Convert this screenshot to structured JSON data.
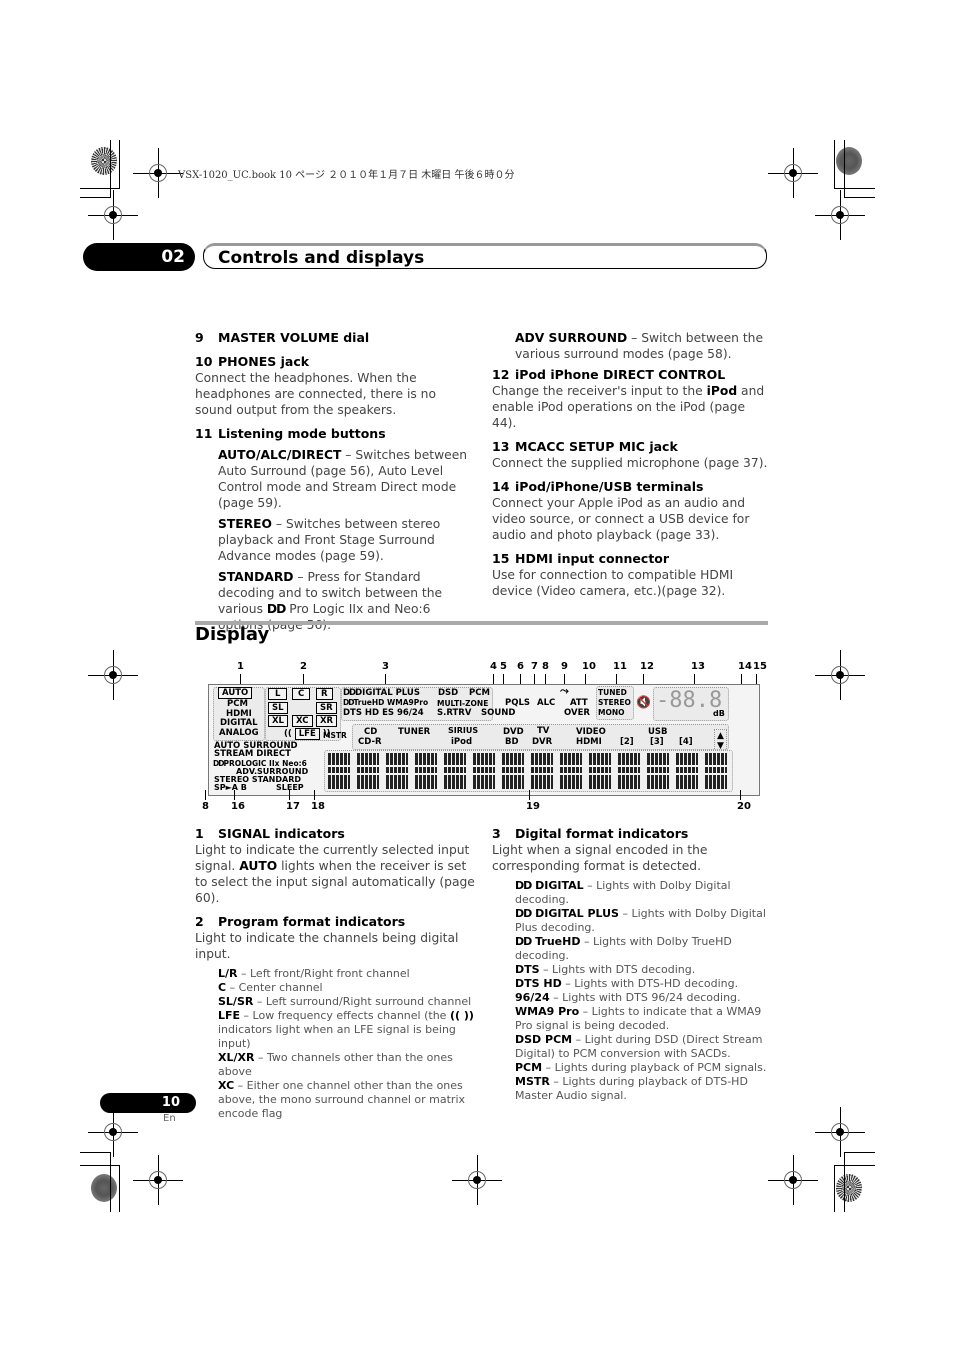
{
  "book_header": "VSX-1020_UC.book  10 ページ  ２０１０年１月７日  木曜日  午後６時０分",
  "chapter": {
    "number": "02",
    "title": "Controls and displays"
  },
  "left_column": [
    {
      "num": "9",
      "title": "MASTER VOLUME dial"
    },
    {
      "num": "10",
      "title": "PHONES jack",
      "body": "Connect the headphones. When the headphones are connected, there is no sound output from the speakers."
    },
    {
      "num": "11",
      "title": "Listening mode buttons",
      "items": [
        {
          "term": "AUTO/ALC/DIRECT",
          "desc": " – Switches between Auto Surround (page 56), Auto Level Control mode and Stream Direct mode (page 59)."
        },
        {
          "term": "STEREO",
          "desc": " – Switches between stereo playback and Front Stage Surround Advance modes (page 59)."
        },
        {
          "term": "STANDARD",
          "desc": " – Press for Standard decoding and to switch between the various ",
          "dolby": "DD",
          "desc2": " Pro Logic IIx and Neo:6 options (page 56)."
        }
      ]
    }
  ],
  "right_column": {
    "adv": {
      "term": "ADV SURROUND",
      "desc": " – Switch between the various surround modes (page 58)."
    },
    "sections": [
      {
        "num": "12",
        "title": "iPod iPhone DIRECT CONTROL",
        "body_pre": "Change the receiver's input to the ",
        "body_bold": "iPod",
        "body_post": " and enable iPod operations on the iPod (page 44)."
      },
      {
        "num": "13",
        "title": "MCACC SETUP MIC jack",
        "body": "Connect the supplied microphone (page 37)."
      },
      {
        "num": "14",
        "title": "iPod/iPhone/USB terminals",
        "body": "Connect your Apple iPod as an audio and video source, or connect a USB device for audio and photo playback (page 33)."
      },
      {
        "num": "15",
        "title": "HDMI input connector",
        "body": "Use for connection to compatible HDMI device (Video camera, etc.)(page 32)."
      }
    ]
  },
  "section_title": "Display",
  "display": {
    "callouts_top": [
      "1",
      "2",
      "3",
      "4",
      "5",
      "6",
      "7",
      "8",
      "9",
      "10",
      "11",
      "12",
      "13",
      "14",
      "15"
    ],
    "callouts_bottom": [
      "8",
      "16",
      "17",
      "18",
      "19",
      "20"
    ],
    "signal": [
      "AUTO",
      "PCM",
      "HDMI",
      "DIGITAL",
      "ANALOG"
    ],
    "channels": {
      "l": "L",
      "c": "C",
      "r": "R",
      "sl": "SL",
      "sr": "SR",
      "xl": "XL",
      "xc": "XC",
      "xr": "XR",
      "lfe": "LFE",
      "lfe_open": "((",
      "lfe_close": "))",
      "mstr": "MSTR"
    },
    "formats": {
      "dd_plus": "DIGITAL PLUS",
      "truehd": "TrueHD",
      "wma": "WMA9Pro",
      "dts_line": "DTS HD  ES  96/24",
      "dsd": "DSD",
      "pcm": "PCM"
    },
    "multi": {
      "zone": "MULTI-ZONE",
      "srtrv": "S.RTRV",
      "sound": "SOUND",
      "pqls": "PQLS",
      "alc": "ALC",
      "att": "ATT",
      "over": "OVER"
    },
    "tuner": [
      "TUNED",
      "STEREO",
      "MONO"
    ],
    "inputs_row1": [
      "CD",
      "TUNER",
      "SIRIUS",
      "DVD",
      "TV",
      "VIDEO",
      "USB"
    ],
    "inputs_row2": [
      "CD-R",
      "iPod",
      "BD",
      "DVR",
      "HDMI",
      "[2]",
      "[3]",
      "[4]"
    ],
    "modes": {
      "auto_surround": "AUTO SURROUND",
      "stream_direct": "STREAM DIRECT",
      "prologic": "PROLOGIC IIx Neo:6",
      "adv": "ADV.SURROUND",
      "stereo_std": "STEREO  STANDARD",
      "sp": "SP►A B",
      "sleep": "SLEEP"
    },
    "db": "dB",
    "matrix_cells": 14
  },
  "lower_left": [
    {
      "num": "1",
      "title": "SIGNAL indicators",
      "body_pre": "Light to indicate the currently selected input signal. ",
      "body_bold": "AUTO",
      "body_post": " lights when the receiver is set to select the input signal automatically (page 60)."
    },
    {
      "num": "2",
      "title": "Program format indicators",
      "body": "Light to indicate the channels being digital input.",
      "items": [
        {
          "term": "L/R",
          "desc": " – Left front/Right front channel"
        },
        {
          "term": "C",
          "desc": " – Center channel"
        },
        {
          "term": "SL/SR",
          "desc": " – Left surround/Right surround channel"
        },
        {
          "term": "LFE",
          "desc": " – Low frequency effects channel (the ",
          "bold2": "((   ))",
          "desc2": " indicators light when an LFE signal is being input)"
        },
        {
          "term": "XL/XR",
          "desc": " – Two channels other than the ones above"
        },
        {
          "term": "XC",
          "desc": " – Either one channel other than the ones above, the mono surround channel or matrix encode flag"
        }
      ]
    }
  ],
  "lower_right": {
    "num": "3",
    "title": "Digital format indicators",
    "body": "Light when a signal encoded in the corresponding format is detected.",
    "items": [
      {
        "dolby": "DD",
        "term": " DIGITAL",
        "desc": " – Lights with Dolby Digital decoding."
      },
      {
        "dolby": "DD",
        "term": " DIGITAL PLUS",
        "desc": " – Lights with Dolby Digital Plus decoding."
      },
      {
        "dolby": "DD",
        "term": " TrueHD",
        "desc": " – Lights with Dolby TrueHD decoding."
      },
      {
        "term": "DTS",
        "desc": " – Lights with DTS decoding."
      },
      {
        "term": "DTS HD",
        "desc": " – Lights with DTS-HD decoding."
      },
      {
        "term": "96/24",
        "desc": " – Lights with DTS 96/24 decoding."
      },
      {
        "term": "WMA9 Pro",
        "desc": " – Lights to indicate that a WMA9 Pro signal is being decoded."
      },
      {
        "term": "DSD PCM",
        "desc": " – Light during DSD (Direct Stream Digital) to PCM conversion with SACDs."
      },
      {
        "term": "PCM",
        "desc": " – Lights during playback of PCM signals."
      },
      {
        "term": "MSTR",
        "desc": " – Lights during playback of DTS-HD Master Audio signal."
      }
    ]
  },
  "footer": {
    "page": "10",
    "lang": "En"
  }
}
